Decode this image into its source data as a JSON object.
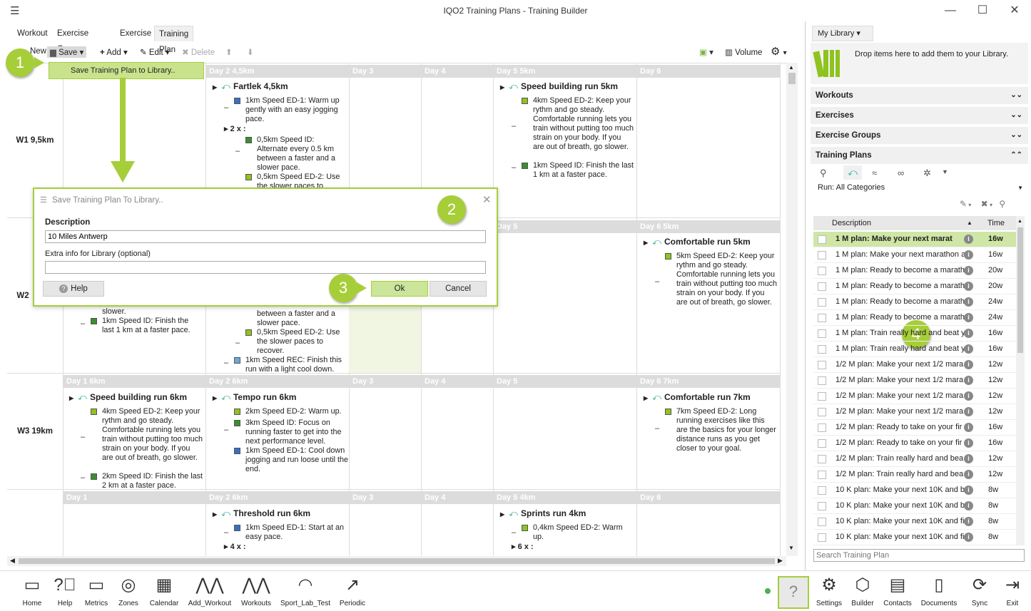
{
  "window": {
    "title": "IQO2 Training Plans - Training Builder",
    "menu_icon": "hamburger-icon",
    "min": "—",
    "max": "☐",
    "close": "✕"
  },
  "tabs": [
    "Workout",
    "Exercise Group",
    "Exercise",
    "Training Plan"
  ],
  "toolbar": {
    "new": "New",
    "save": "Save",
    "add": "Add",
    "edit": "Edit",
    "delete": "Delete",
    "volume": "Volume"
  },
  "save_menu": {
    "item": "Save Training Plan to Library.."
  },
  "grid": {
    "weeks": [
      "W1 9,5km",
      "W2",
      "W3 19km"
    ],
    "w1": {
      "day2": "Day 2 4,5km",
      "day3": "Day 3",
      "day4": "Day 4",
      "day5": "Day 5 5km",
      "day6": "Day 6",
      "fartlek": "Fartlek 4,5km",
      "f1": "1km Speed ED-1: Warm up gently with an easy jogging pace.",
      "frep": "2 x :",
      "f2": "0,5km Speed ID: Alternate every 0.5 km between a faster and a slower pace.",
      "f3": "0,5km Speed ED-2: Use the slower paces to",
      "sb": "Speed building run 5km",
      "sb1": "4km Speed ED-2: Keep your rythm and go steady. Comfortable running lets you train without putting too much strain on your body. If you are out of breath, go slower.",
      "sb2": "1km Speed ID: Finish the last 1 km at a faster pace."
    },
    "w2": {
      "day5": "Day 5",
      "day6": "Day 6 5km",
      "c5": "Comfortable run 5km",
      "c5a": "5km Speed ED-2: Keep your rythm and go steady. Comfortable running lets you train without putting too much strain on your body. If you are out of breath, go slower.",
      "a1": "slower.",
      "a2": "1km Speed ID: Finish the last 1 km at a faster pace.",
      "b1": "between a faster and a slower pace.",
      "b2": "0,5km Speed ED-2: Use the slower paces to recover.",
      "b3": "1km Speed REC: Finish this run with a light cool down."
    },
    "w3": {
      "day1": "Day 1 6km",
      "day2": "Day 2 6km",
      "day3": "Day 3",
      "day4": "Day 4",
      "day5": "Day 5",
      "day6": "Day 6 7km",
      "sb": "Speed building run 6km",
      "sb1": "4km Speed ED-2: Keep your rythm and go steady. Comfortable running lets you train without putting too much strain on your body. If you are out of breath, go slower.",
      "sb2": "2km Speed ID: Finish the last 2 km at a faster pace.",
      "tr": "Tempo run 6km",
      "tr1": "2km Speed ED-2: Warm up.",
      "tr2": "3km Speed ID: Focus on running faster to get into the next performance level.",
      "tr3": "1km Speed ED-1: Cool down jogging and run loose until the end.",
      "cr": "Comfortable run 7km",
      "cr1": "7km Speed ED-2: Long running exercises like this are the basics for your longer distance runs as you get closer to your goal."
    },
    "w4": {
      "day1": "Day 1",
      "day2": "Day 2 6km",
      "day3": "Day 3",
      "day4": "Day 4",
      "day5": "Day 5 4km",
      "day6": "Day 6",
      "th": "Threshold run 6km",
      "th1": "1km Speed ED-1: Start at an easy pace.",
      "threp": "4 x :",
      "sp": "Sprints run 4km",
      "sp1": "0,4km Speed ED-2: Warm up.",
      "sprep": "6 x :"
    }
  },
  "dialog": {
    "title": "Save Training Plan To Library..",
    "desc_label": "Description",
    "desc_value": "10 Miles Antwerp",
    "extra_label": "Extra info for Library (optional)",
    "extra_value": "",
    "help": "Help",
    "ok": "Ok",
    "cancel": "Cancel"
  },
  "callouts": [
    "1",
    "2",
    "3",
    "4"
  ],
  "library": {
    "dropdown": "My Library",
    "drop_text": "Drop items here to add them to your Library.",
    "sections": [
      "Workouts",
      "Exercises",
      "Exercise Groups",
      "Training Plans"
    ],
    "filter": "Run: All Categories",
    "col_desc": "Description",
    "col_time": "Time",
    "rows": [
      {
        "d": "1 M plan: Make your next marat",
        "t": "16w"
      },
      {
        "d": "1 M plan: Make your next marathon a",
        "t": "16w"
      },
      {
        "d": "1 M plan: Ready to become a marath",
        "t": "20w"
      },
      {
        "d": "1 M plan: Ready to become a marath",
        "t": "20w"
      },
      {
        "d": "1 M plan: Ready to become a marath",
        "t": "24w"
      },
      {
        "d": "1 M plan: Ready to become a marath",
        "t": "24w"
      },
      {
        "d": "1 M plan: Train really hard and beat y",
        "t": "16w"
      },
      {
        "d": "1 M plan: Train really hard and beat y",
        "t": "16w"
      },
      {
        "d": "1/2 M plan: Make your next 1/2 mara",
        "t": "12w"
      },
      {
        "d": "1/2 M plan: Make your next 1/2 mara",
        "t": "12w"
      },
      {
        "d": "1/2 M plan: Make your next 1/2 mara",
        "t": "12w"
      },
      {
        "d": "1/2 M plan: Make your next 1/2 mara",
        "t": "12w"
      },
      {
        "d": "1/2 M plan: Ready to take on your fir",
        "t": "16w"
      },
      {
        "d": "1/2 M plan: Ready to take on your fir",
        "t": "16w"
      },
      {
        "d": "1/2 M plan: Train really hard and bea",
        "t": "12w"
      },
      {
        "d": "1/2 M plan: Train really hard and bea",
        "t": "12w"
      },
      {
        "d": "10 K plan: Make your next 10K and b",
        "t": "8w"
      },
      {
        "d": "10 K plan: Make your next 10K and b",
        "t": "8w"
      },
      {
        "d": "10 K plan: Make your next 10K and fi",
        "t": "8w"
      },
      {
        "d": "10 K plan: Make your next 10K and fi",
        "t": "8w"
      }
    ],
    "search": "Search Training Plan"
  },
  "bottom": [
    "Home",
    "Help",
    "Metrics",
    "Zones",
    "Calendar",
    "Add_Workout",
    "Workouts",
    "Sport_Lab_Test",
    "Periodic",
    "Settings",
    "Builder",
    "Contacts",
    "Documents",
    "Sync",
    "Exit"
  ],
  "colors": {
    "accent": "#a6ce39",
    "step_ed2": "#8fc31f",
    "step_id": "#3a8f2e",
    "step_ed1": "#3b6fc4",
    "step_rec": "#6aa9d8"
  }
}
